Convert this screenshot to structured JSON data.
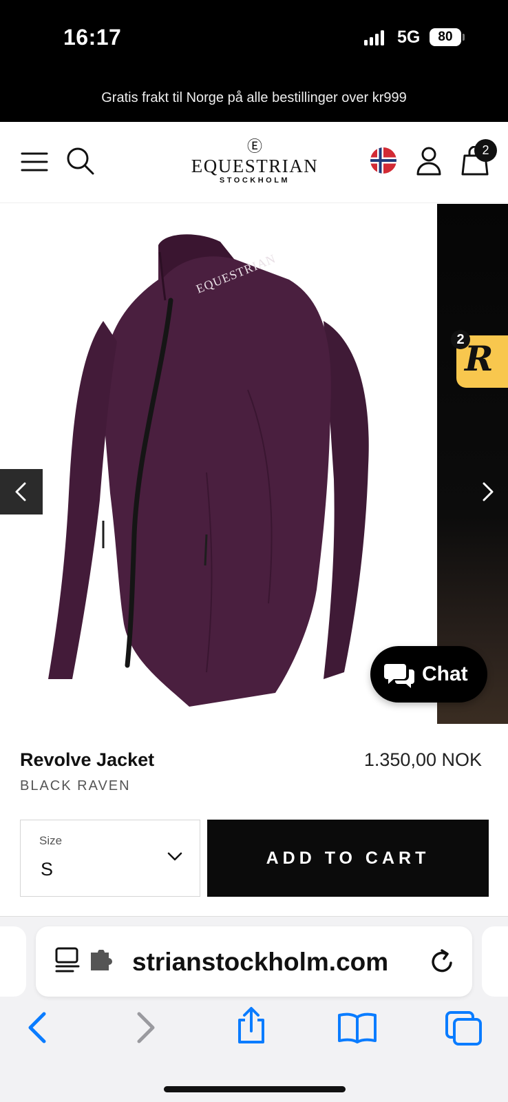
{
  "status_bar": {
    "time": "16:17",
    "network": "5G",
    "battery": "80"
  },
  "promo_banner": {
    "text": "Gratis frakt til Norge på alle bestillinger over kr999"
  },
  "header": {
    "logo": {
      "mark": "Ⓔ",
      "name": "EQUESTRIAN",
      "sub": "STOCKHOLM"
    },
    "cart_count": "2",
    "icons": [
      "menu-icon",
      "search-icon",
      "norway-flag-icon",
      "account-icon",
      "cart-icon"
    ]
  },
  "gallery": {
    "rewards_count": "2",
    "rewards_letter": "R",
    "chat_label": "Chat",
    "jacket_color": "#4a1f3f",
    "collar_text": "EQUESTRIAN"
  },
  "product": {
    "name": "Revolve Jacket",
    "price": "1.350,00 NOK",
    "variant": "BLACK RAVEN",
    "size_label": "Size",
    "size_value": "S",
    "add_to_cart": "ADD TO CART"
  },
  "browser": {
    "url": "strianstockholm.com",
    "toolbar": [
      "back-icon",
      "forward-icon",
      "share-icon",
      "bookmarks-icon",
      "tabs-icon"
    ],
    "accent": "#0a7cff"
  }
}
